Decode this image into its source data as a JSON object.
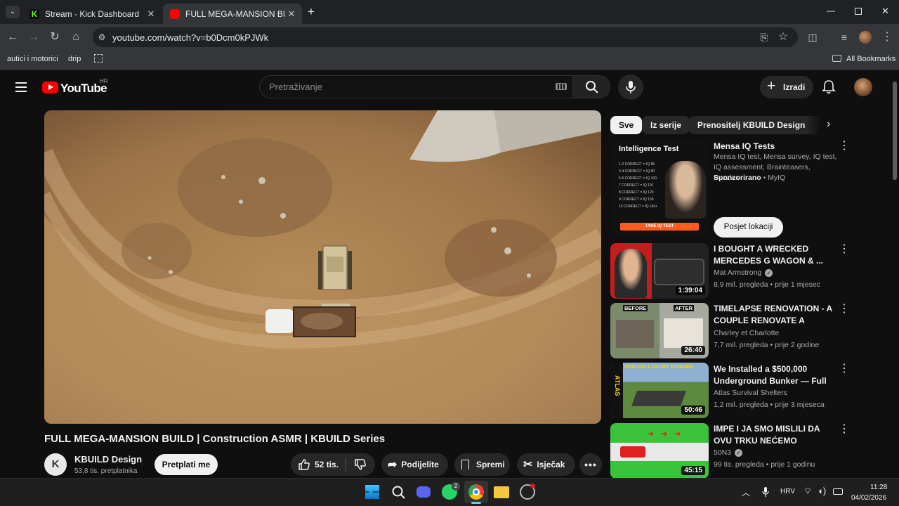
{
  "browser": {
    "tabs": [
      {
        "title": "Stream - Kick Dashboard",
        "active": false
      },
      {
        "title": "FULL MEGA-MANSION BUILD | ",
        "active": true
      }
    ],
    "url": "youtube.com/watch?v=b0Dcm0kPJWk",
    "bookmarks": [
      "autici i motorici",
      "drip"
    ],
    "all_bookmarks": "All Bookmarks"
  },
  "youtube": {
    "logo_text": "YouTube",
    "region": "HR",
    "search_placeholder": "Pretraživanje",
    "create_label": "Izradi",
    "video": {
      "title": "FULL MEGA-MANSION BUILD | Construction ASMR | KBUILD Series",
      "channel": "KBUILD Design",
      "subscribers": "53,8 tis. pretplatnika",
      "subscribe_label": "Pretplati me",
      "likes": "52 tis.",
      "share_label": "Podijelite",
      "save_label": "Spremi",
      "clip_label": "Isječak"
    },
    "chips": [
      "Sve",
      "Iz serije",
      "Prenositelj KBUILD Design"
    ],
    "ad": {
      "thumb_title": "Intelligence Test",
      "thumb_lines": [
        "1-2 CORRECT = IQ 85",
        "3-4 CORRECT = IQ 90",
        "5-6 CORRECT = IQ 100",
        "7 CORRECT = IQ 110",
        "8 CORRECT = IQ 120",
        "9 CORRECT = IQ 130",
        "10 CORRECT = IQ 140+"
      ],
      "thumb_cta": "TAKE IQ TEST",
      "title": "Mensa IQ Tests",
      "description": "Mensa IQ test, Mensa survey, IQ test, IQ assessment, Brainteasers, Puzzles",
      "sponsored": "Sponzorirano",
      "advertiser": "MyIQ",
      "visit_label": "Posjet lokaciji"
    },
    "related": [
      {
        "title": "I BOUGHT A WRECKED MERCEDES G WAGON & ...",
        "channel": "Mat Armstrong",
        "verified": true,
        "views": "8,9 mil. pregleda",
        "age": "prije 1 mjesec",
        "duration": "1:39:04",
        "thumb_labels": []
      },
      {
        "title": "TIMELAPSE  RENOVATION - A COUPLE RENOVATE A FRENC...",
        "channel": "Charley et Charlotte",
        "verified": false,
        "views": "7,7 mil. pregleda",
        "age": "prije 2 godine",
        "duration": "26:40",
        "thumb_labels": [
          "BEFORE",
          "AFTER"
        ]
      },
      {
        "title": "We Installed a $500,000 Underground Bunker — Full ...",
        "channel": "Atlas Survival Shelters",
        "verified": false,
        "views": "1,2 mil. pregleda",
        "age": "prije 3 mjeseca",
        "duration": "50:46",
        "thumb_labels": [
          "$500,000 LUXURY BUNKER",
          "ATLAS"
        ]
      },
      {
        "title": "IMPE I JA SMO MISLILI DA OVU TRKU NEĆEMO ZAVRŠITI U G...",
        "channel": "50N3",
        "verified": true,
        "views": "99 tis. pregleda",
        "age": "prije 1 godinu",
        "duration": "45:15",
        "thumb_labels": []
      }
    ]
  },
  "taskbar": {
    "whatsapp_badge": "2",
    "language": "HRV",
    "time": "11:28",
    "date": "04/02/2026"
  }
}
